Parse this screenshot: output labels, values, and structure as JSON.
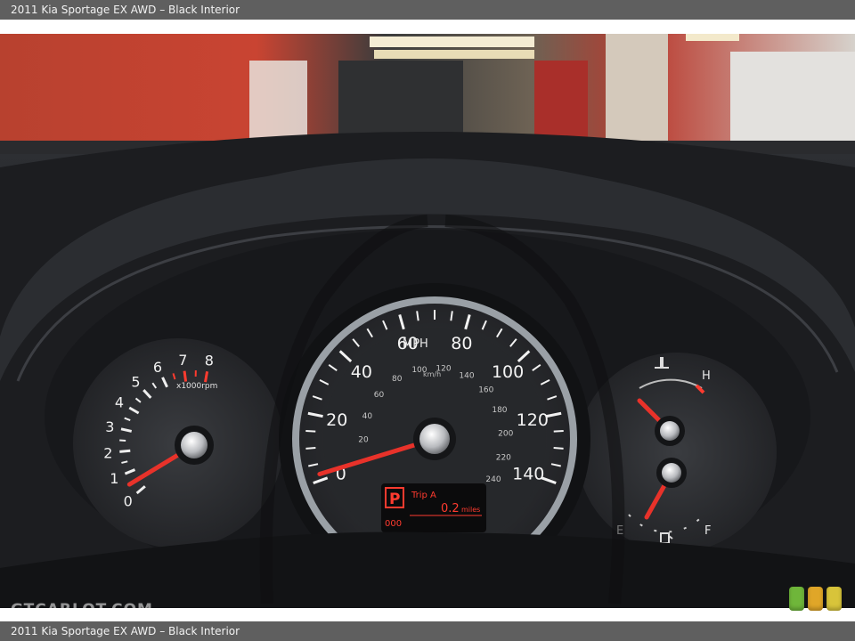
{
  "caption": {
    "top": "2011 Kia Sportage EX AWD – Black Interior",
    "bottom": "2011 Kia Sportage EX AWD – Black Interior"
  },
  "watermark": "GTCARLOT.COM",
  "photo": {
    "speedometer": {
      "unit": "MPH",
      "unit_secondary": "km/h",
      "mph_labels": [
        "0",
        "20",
        "40",
        "60",
        "80",
        "100",
        "120",
        "140"
      ],
      "kmh_labels": [
        "20",
        "40",
        "60",
        "80",
        "100",
        "120",
        "140",
        "160",
        "180",
        "200",
        "220",
        "240"
      ],
      "needle_mph": 0
    },
    "tachometer": {
      "labels": [
        "0",
        "1",
        "2",
        "3",
        "4",
        "5",
        "6",
        "7",
        "8"
      ],
      "unit": "x1000rpm",
      "needle_krpm": 0.5
    },
    "temp_gauge": {
      "high_label": "H"
    },
    "fuel_gauge": {
      "empty_label": "E",
      "full_label": "F"
    },
    "lcd": {
      "gear": "P",
      "trip_label": "Trip A",
      "trip_value": "0.2",
      "trip_unit": "miles",
      "odometer": "000"
    }
  },
  "badges": [
    {
      "name": "green-badge",
      "color": "#6fb63a"
    },
    {
      "name": "orange-badge",
      "color": "#e0a628"
    },
    {
      "name": "yellow-badge",
      "color": "#d8c43a"
    }
  ]
}
